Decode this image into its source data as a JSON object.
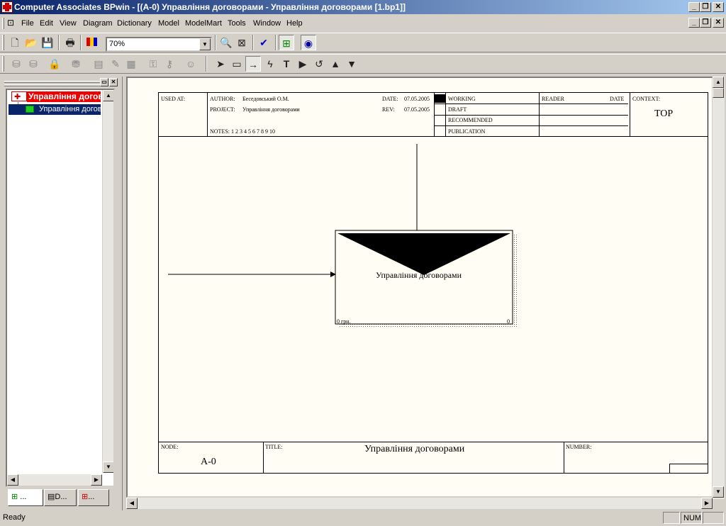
{
  "window": {
    "title": "Computer Associates BPwin - [(A-0) Управління договорами - Управління договорами  [1.bp1]]"
  },
  "menu": [
    "File",
    "Edit",
    "View",
    "Diagram",
    "Dictionary",
    "Model",
    "ModelMart",
    "Tools",
    "Window",
    "Help"
  ],
  "toolbar": {
    "zoom_value": "70%"
  },
  "tree": {
    "root_label": "Управління догов",
    "child_label": "Управління догов"
  },
  "tabs": [
    "...",
    "D...",
    "..."
  ],
  "diagram": {
    "header": {
      "used_at": "USED AT:",
      "author_label": "AUTHOR:",
      "author_value": "Беседовський О.М.",
      "project_label": "PROJECT:",
      "project_value": "Управління договорами",
      "date_label": "DATE:",
      "date_value": "07.05.2005",
      "rev_label": "REV:",
      "rev_value": "07.05.2005",
      "notes": "NOTES:  1  2  3  4  5  6  7  8  9  10",
      "statuses": [
        "WORKING",
        "DRAFT",
        "RECOMMENDED",
        "PUBLICATION"
      ],
      "reader": "READER",
      "date": "DATE",
      "context": "CONTEXT:",
      "context_value": "TOP"
    },
    "box": {
      "label": "Управління договорами",
      "cost": "0 грн.",
      "number": "0"
    },
    "footer": {
      "node_label": "NODE:",
      "node_value": "A-0",
      "title_label": "TITLE:",
      "title_value": "Управління договорами",
      "number_label": "NUMBER:"
    }
  },
  "status": {
    "text": "Ready",
    "num": "NUM"
  }
}
